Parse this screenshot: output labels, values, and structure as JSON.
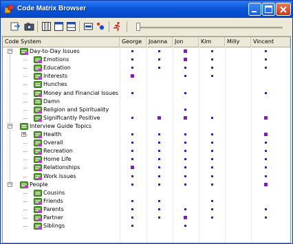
{
  "window": {
    "title": "Code Matrix Browser"
  },
  "toolbar": {
    "buttons": [
      "export-icon",
      "camera-icon",
      "layout-columns-icon",
      "layout-rows-icon",
      "layout-split-icon",
      "node-icon",
      "dot-color-icon",
      "runner-icon"
    ]
  },
  "columns": {
    "code_system": "Code System",
    "docs": [
      "George",
      "Joanna",
      "Jon",
      "Kim",
      "Milly",
      "Vincent"
    ]
  },
  "colors": {
    "dot": "#3b18c9",
    "square": "#7b1fb4",
    "title_bar": "#0a55d8"
  },
  "rows": [
    {
      "label": "Day-to-Day Issues",
      "level": 0,
      "expander": "−",
      "marks": [
        "dot",
        "dot",
        "sq",
        "dot",
        "",
        "dot"
      ]
    },
    {
      "label": "Emotions",
      "level": 1,
      "expander": "",
      "marks": [
        "dot",
        "dot",
        "sq",
        "dot",
        "",
        "dot"
      ]
    },
    {
      "label": "Education",
      "level": 1,
      "expander": "",
      "marks": [
        "dot",
        "dot",
        "dot",
        "dot",
        "",
        "dot"
      ]
    },
    {
      "label": "Interests",
      "level": 1,
      "expander": "",
      "marks": [
        "sq",
        "",
        "dot",
        "dot",
        "",
        ""
      ]
    },
    {
      "label": "Hunches",
      "level": 1,
      "expander": "",
      "marks": [
        "",
        "",
        "",
        "",
        "",
        ""
      ]
    },
    {
      "label": "Money and Financial Issues",
      "level": 1,
      "expander": "",
      "marks": [
        "dot",
        "",
        "dot",
        "",
        "",
        "dot"
      ]
    },
    {
      "label": "Damn",
      "level": 1,
      "expander": "",
      "marks": [
        "",
        "",
        "",
        "",
        "",
        ""
      ]
    },
    {
      "label": "Religion and Spirituality",
      "level": 1,
      "expander": "",
      "marks": [
        "",
        "",
        "dot",
        "",
        "",
        ""
      ]
    },
    {
      "label": "Significantly Positive",
      "level": 1,
      "expander": "",
      "marks": [
        "dot",
        "sq",
        "sq",
        "dot",
        "",
        "sq"
      ]
    },
    {
      "label": "Interview Guide Topics",
      "level": 0,
      "expander": "−",
      "marks": [
        "",
        "",
        "",
        "",
        "",
        ""
      ]
    },
    {
      "label": "Health",
      "level": 1,
      "expander": "+",
      "marks": [
        "dot",
        "dot",
        "dot",
        "dot",
        "",
        "sq"
      ]
    },
    {
      "label": "Overall",
      "level": 1,
      "expander": "",
      "marks": [
        "dot",
        "dot",
        "dot",
        "dot",
        "",
        "dot"
      ]
    },
    {
      "label": "Recreation",
      "level": 1,
      "expander": "",
      "marks": [
        "dot",
        "dot",
        "dot",
        "dot",
        "",
        "dot"
      ]
    },
    {
      "label": "Home Life",
      "level": 1,
      "expander": "",
      "marks": [
        "dot",
        "dot",
        "dot",
        "dot",
        "",
        "dot"
      ]
    },
    {
      "label": "Relationships",
      "level": 1,
      "expander": "",
      "marks": [
        "sq",
        "dot",
        "dot",
        "dot",
        "",
        "dot"
      ]
    },
    {
      "label": "Work Issues",
      "level": 1,
      "expander": "",
      "marks": [
        "dot",
        "dot",
        "dot",
        "dot",
        "",
        "dot"
      ]
    },
    {
      "label": "People",
      "level": 0,
      "expander": "−",
      "marks": [
        "dot",
        "dot",
        "dot",
        "dot",
        "",
        "sq"
      ]
    },
    {
      "label": "Cousins",
      "level": 1,
      "expander": "",
      "marks": [
        "",
        "",
        "",
        "",
        "",
        ""
      ]
    },
    {
      "label": "Friends",
      "level": 1,
      "expander": "",
      "marks": [
        "dot",
        "dot",
        "",
        "dot",
        "",
        ""
      ]
    },
    {
      "label": "Parents",
      "level": 1,
      "expander": "",
      "marks": [
        "dot",
        "dot",
        "dot",
        "dot",
        "",
        "dot"
      ]
    },
    {
      "label": "Partner",
      "level": 1,
      "expander": "",
      "marks": [
        "dot",
        "dot",
        "sq",
        "dot",
        "",
        "dot"
      ]
    },
    {
      "label": "Siblings",
      "level": 1,
      "expander": "",
      "marks": [
        "dot",
        "",
        "dot",
        "",
        "",
        ""
      ]
    }
  ]
}
